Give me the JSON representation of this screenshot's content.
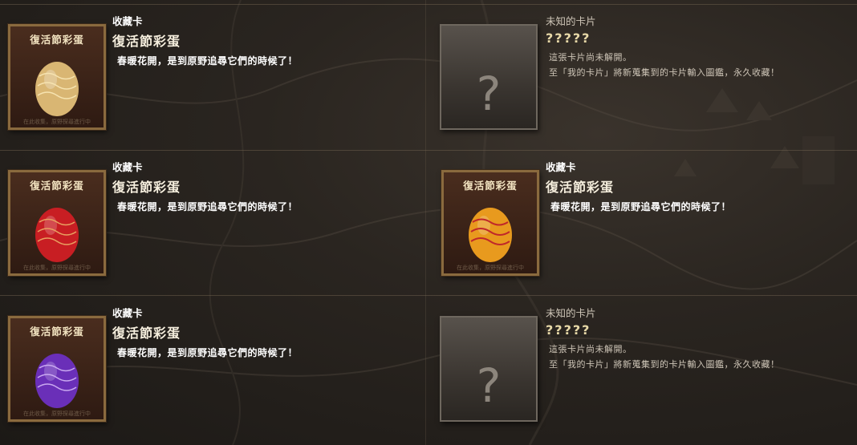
{
  "cards": [
    {
      "state": "known",
      "category": "收藏卡",
      "name": "復活節彩蛋",
      "description": "春暖花開，是到原野追尋它們的時候了！",
      "card_title": "復活節彩蛋",
      "card_footer": "在此收集，原野探尋進行中",
      "egg_color": "#d9b673",
      "egg_pattern": "#f6e3b0"
    },
    {
      "state": "unknown",
      "category": "未知的卡片",
      "name": "?????",
      "line1": "這張卡片尚未解開。",
      "line2": "至「我的卡片」將新蒐集到的卡片輸入圖鑑，永久收藏！",
      "card_symbol": "?"
    },
    {
      "state": "known",
      "category": "收藏卡",
      "name": "復活節彩蛋",
      "description": "春暖花開，是到原野追尋它們的時候了！",
      "card_title": "復活節彩蛋",
      "card_footer": "在此收集，原野探尋進行中",
      "egg_color": "#c81e23",
      "egg_pattern": "#e8a060"
    },
    {
      "state": "known",
      "category": "收藏卡",
      "name": "復活節彩蛋",
      "description": "春暖花開，是到原野追尋它們的時候了！",
      "card_title": "復活節彩蛋",
      "card_footer": "在此收集，原野探尋進行中",
      "egg_color": "#e89a1e",
      "egg_pattern": "#c0282a"
    },
    {
      "state": "known",
      "category": "收藏卡",
      "name": "復活節彩蛋",
      "description": "春暖花開，是到原野追尋它們的時候了！",
      "card_title": "復活節彩蛋",
      "card_footer": "在此收集，原野探尋進行中",
      "egg_color": "#6a2fb8",
      "egg_pattern": "#c9a8f0"
    },
    {
      "state": "unknown",
      "category": "未知的卡片",
      "name": "?????",
      "line1": "這張卡片尚未解開。",
      "line2": "至「我的卡片」將新蒐集到的卡片輸入圖鑑，永久收藏！",
      "card_symbol": "?"
    }
  ]
}
